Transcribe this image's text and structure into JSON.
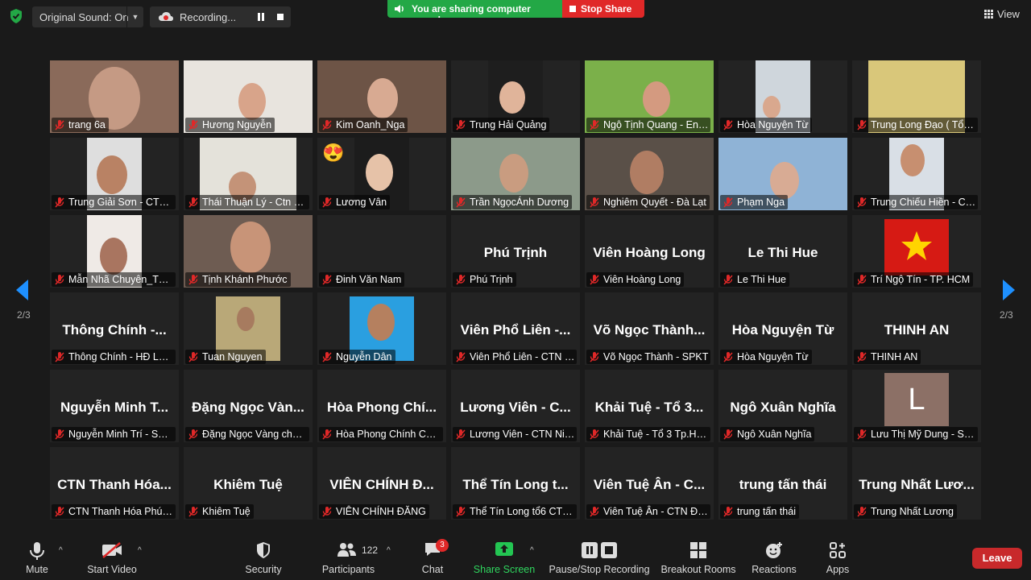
{
  "top": {
    "original_sound": "Original Sound: On",
    "recording": "Recording...",
    "sharing_sound": "You are sharing computer sound",
    "stop_share": "Stop Share",
    "view": "View"
  },
  "pager": {
    "left": "2/3",
    "right": "2/3"
  },
  "participants": [
    {
      "name": "trang 6a"
    },
    {
      "name": "Hương Nguyễn"
    },
    {
      "name": "Kim Oanh_Nga"
    },
    {
      "name": "Trung Hải Quảng"
    },
    {
      "name": "Ngộ Tịnh Quang - Eng..."
    },
    {
      "name": "Hòa Nguyện Từ"
    },
    {
      "name": "Trung Long Đạo ( Tổ L..."
    },
    {
      "name": "Trung Giải Sơn - CTN ..."
    },
    {
      "name": "Thái Thuận Lý - Ctn Đà..."
    },
    {
      "name": "Lương Vân"
    },
    {
      "name": "Trần NgọcÁnh Dương"
    },
    {
      "name": "Nghiêm Quyết - Đà Lạt"
    },
    {
      "name": "Phạm Nga"
    },
    {
      "name": "Trung Chiếu Hiền - CT..."
    },
    {
      "name": "Mẫn Nhã Chuyên_Tổ 3..."
    },
    {
      "name": "Tịnh Khánh Phước"
    },
    {
      "name": "Đinh Văn Nam"
    },
    {
      "name": "Phú Trịnh",
      "big": "Phú Trịnh"
    },
    {
      "name": "Viên Hoàng Long",
      "big": "Viên Hoàng Long"
    },
    {
      "name": "Le Thi Hue",
      "big": "Le Thi Hue"
    },
    {
      "name": "Trí Ngộ Tín - TP. HCM"
    },
    {
      "name": "Thông Chính - HĐ Lon...",
      "big": "Thông Chính -..."
    },
    {
      "name": "Tuan Nguyen"
    },
    {
      "name": "Nguyễn Dân"
    },
    {
      "name": "Viên Phổ Liên - CTN H...",
      "big": "Viên Phổ Liên -..."
    },
    {
      "name": "Võ Ngọc Thành - SPKT",
      "big": "Võ Ngọc Thành..."
    },
    {
      "name": "Hòa Nguyện Từ",
      "big": "Hòa Nguyện Từ"
    },
    {
      "name": "THINH AN",
      "big": "THINH AN"
    },
    {
      "name": "Nguyễn Minh Trí - SPKT",
      "big": "Nguyễn Minh T..."
    },
    {
      "name": "Đặng Ngọc Vàng chún...",
      "big": "Đặng Ngọc Vàn..."
    },
    {
      "name": "Hòa Phong Chính CTN...",
      "big": "Hòa Phong Chí..."
    },
    {
      "name": "Lương Viên - CTN Nin...",
      "big": "Lương Viên - C..."
    },
    {
      "name": "Khải Tuệ - Tổ 3 Tp.HCM",
      "big": "Khải Tuệ - Tổ 3..."
    },
    {
      "name": "Ngô Xuân Nghĩa",
      "big": "Ngô Xuân Nghĩa"
    },
    {
      "name": "Lưu Thị Mỹ Dung - SP...",
      "avatar_letter": "L"
    },
    {
      "name": "CTN Thanh Hóa Phúc ...",
      "big": "CTN Thanh Hóa..."
    },
    {
      "name": "Khiêm Tuệ",
      "big": "Khiêm Tuệ"
    },
    {
      "name": "VIÊN CHÍNH ĐĂNG",
      "big": "VIÊN CHÍNH Đ..."
    },
    {
      "name": "Thể Tín Long  tổ6 CTN...",
      "big": "Thể Tín Long  t..."
    },
    {
      "name": "Viên Tuệ Ân - CTN Đài...",
      "big": "Viên Tuệ Ân - C..."
    },
    {
      "name": "trung tấn thái",
      "big": "trung tấn thái"
    },
    {
      "name": "Trung Nhất Lương",
      "big": "Trung Nhất Lươ..."
    }
  ],
  "toolbar": {
    "mute": "Mute",
    "start_video": "Start Video",
    "security": "Security",
    "participants": "Participants",
    "participants_count": "122",
    "chat": "Chat",
    "chat_badge": "3",
    "share_screen": "Share Screen",
    "record": "Pause/Stop Recording",
    "breakout": "Breakout Rooms",
    "reactions": "Reactions",
    "apps": "Apps",
    "leave": "Leave"
  },
  "colors": {
    "share_green": "#23a846",
    "stop_red": "#e02828",
    "leave_red": "#c8292b"
  }
}
